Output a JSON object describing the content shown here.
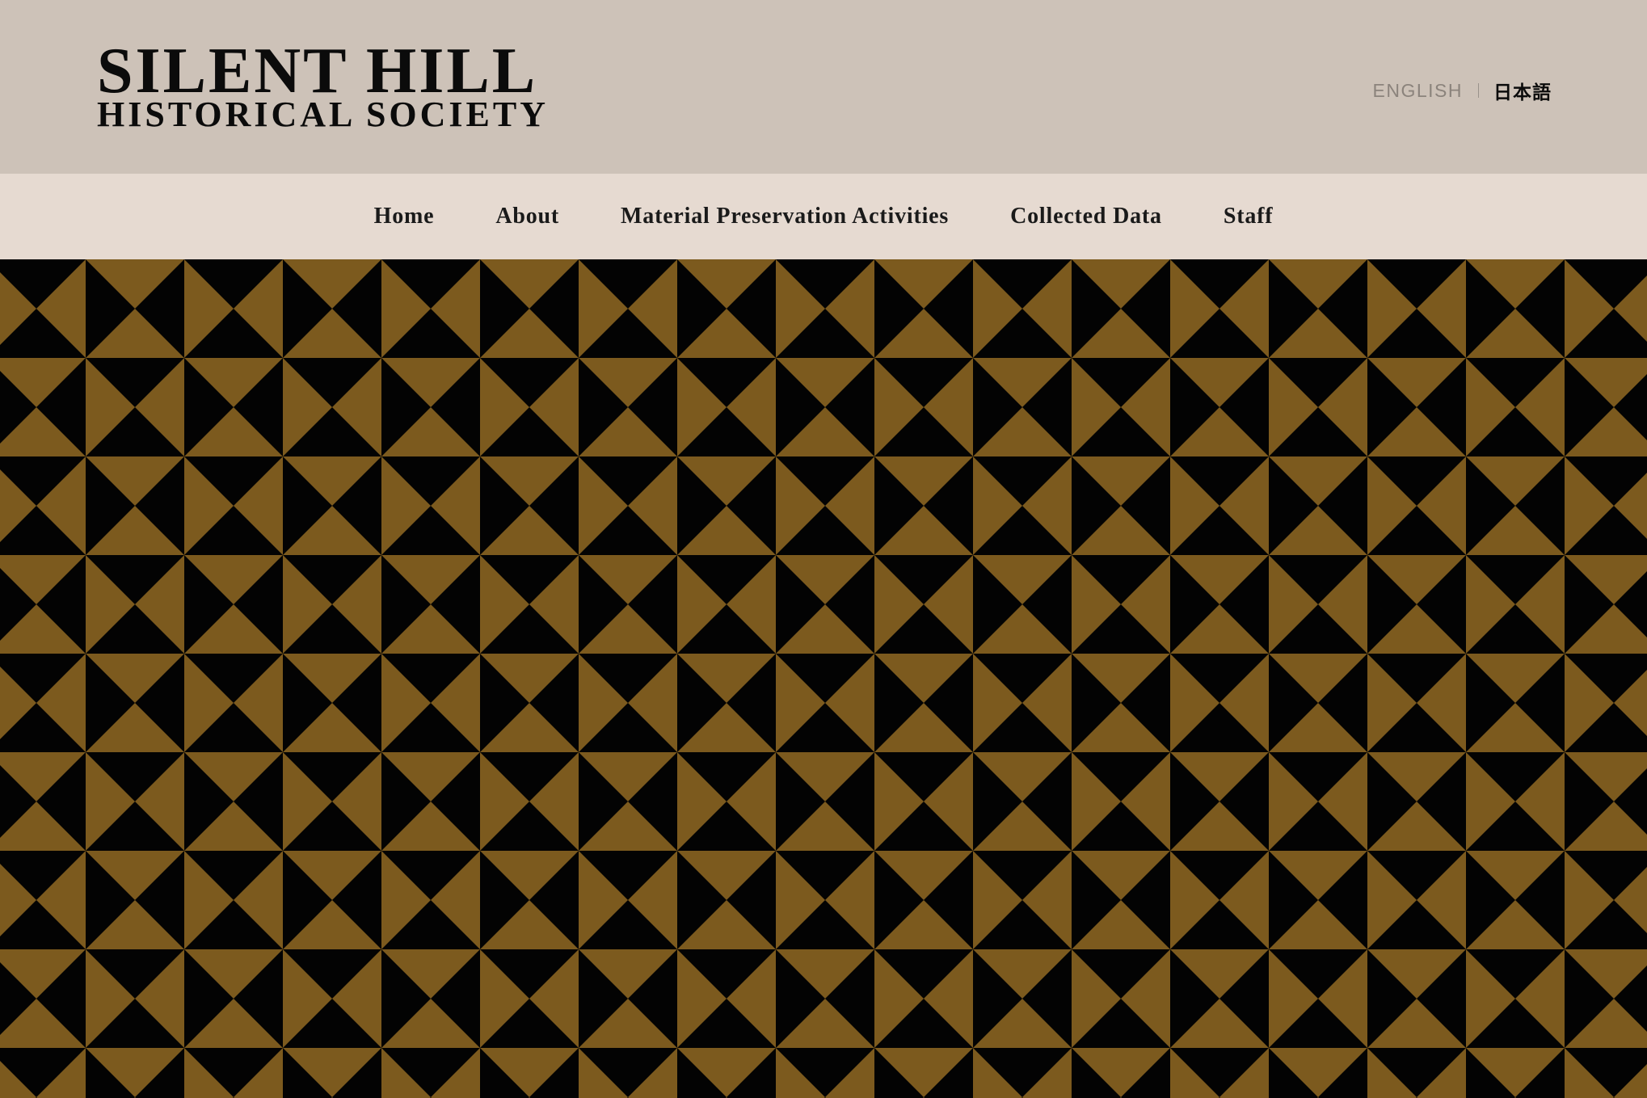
{
  "header": {
    "logo": {
      "line1": "SILENT HILL",
      "line2": "HISTORICAL SOCIETY"
    },
    "languages": {
      "english": "ENGLISH",
      "japanese": "日本語",
      "active": "日本語"
    }
  },
  "nav": {
    "items": [
      {
        "label": "Home"
      },
      {
        "label": "About"
      },
      {
        "label": "Material Preservation Activities"
      },
      {
        "label": "Collected Data"
      },
      {
        "label": "Staff"
      }
    ]
  },
  "hero": {
    "pattern": "triangle-checker",
    "colors": {
      "gold": "#7c5a1e",
      "black": "#030303"
    }
  },
  "colors": {
    "header_bg": "#cdc2b8",
    "nav_bg": "#e6dad1",
    "text": "#0b0b0b",
    "muted_text": "#8b837c"
  }
}
